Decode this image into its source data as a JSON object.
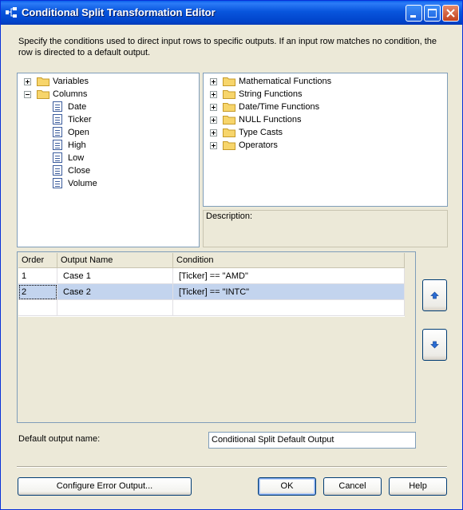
{
  "window": {
    "title": "Conditional Split Transformation Editor"
  },
  "description": "Specify the conditions used to direct input rows to specific outputs. If an input row matches no condition, the row is directed to a default output.",
  "left_tree": {
    "variables": "Variables",
    "columns": "Columns",
    "column_items": [
      "Date",
      "Ticker",
      "Open",
      "High",
      "Low",
      "Close",
      "Volume"
    ]
  },
  "right_tree": {
    "items": [
      "Mathematical Functions",
      "String Functions",
      "Date/Time Functions",
      "NULL Functions",
      "Type Casts",
      "Operators"
    ]
  },
  "description_panel": {
    "label": "Description:"
  },
  "grid": {
    "headers": [
      "Order",
      "Output Name",
      "Condition"
    ],
    "rows": [
      {
        "order": "1",
        "name": "Case 1",
        "condition": "[Ticker] == \"AMD\""
      },
      {
        "order": "2",
        "name": "Case 2",
        "condition": "[Ticker] == \"INTC\""
      }
    ],
    "selected_row": 2
  },
  "default_output": {
    "label": "Default output name:",
    "value": "Conditional Split Default Output"
  },
  "buttons": {
    "configure_error": "Configure Error Output...",
    "ok": "OK",
    "cancel": "Cancel",
    "help": "Help"
  },
  "colors": {
    "selection": "#C3D4EE",
    "titlebar": "#0855DD",
    "dialog": "#ECE9D8"
  }
}
